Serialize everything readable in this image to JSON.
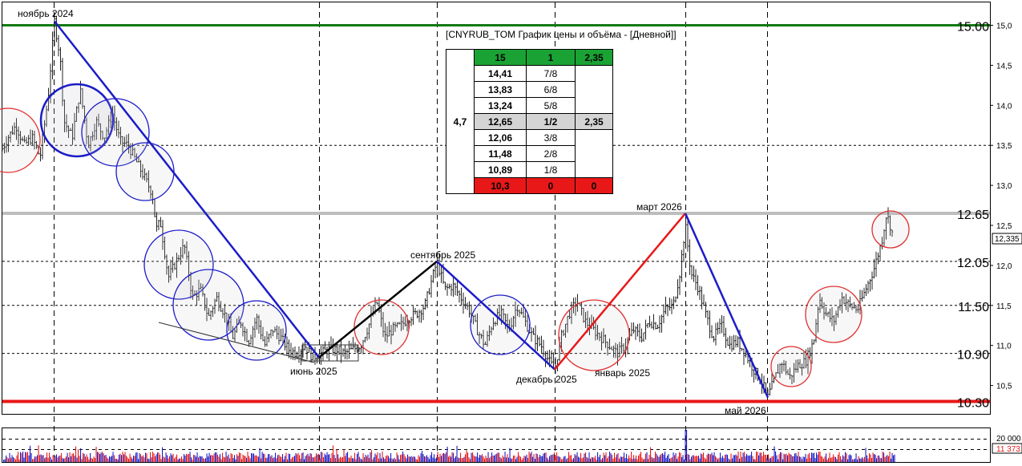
{
  "chart_data": {
    "type": "candlestick",
    "instrument_title": "[CNYRUB_TOM График цены и объёма - [Дневной]]",
    "ylim": [
      10.27,
      15.12
    ],
    "y_ticks": [
      "15,0",
      "14,5",
      "14,0",
      "13,5",
      "13,0",
      "12,5",
      "12,0",
      "11,5",
      "11,0",
      "10,5"
    ],
    "y_tick_values": [
      15.0,
      14.5,
      14.0,
      13.5,
      13.0,
      12.5,
      12.0,
      11.5,
      11.0,
      10.5
    ],
    "levels": [
      {
        "value": 15.0,
        "label": "15.00",
        "color": "#117a11"
      },
      {
        "value": 12.65,
        "label": "12.65",
        "color": "#bdbdbd"
      },
      {
        "value": 12.05,
        "label": "12.05",
        "color": "#000000"
      },
      {
        "value": 11.5,
        "label": "11.50",
        "color": "#000000"
      },
      {
        "value": 10.9,
        "label": "10.90",
        "color": "#000000"
      },
      {
        "value": 10.3,
        "label": "10.30",
        "color": "#e81818"
      }
    ],
    "last_price": "12,335",
    "volume_ticks": [
      "20 000",
      "11 373"
    ],
    "swing_labels": [
      {
        "label": "ноябрь 2024",
        "value": 15.05
      },
      {
        "label": "июнь 2025",
        "value": 10.85
      },
      {
        "label": "сентябрь 2025",
        "value": 12.05
      },
      {
        "label": "декабрь 2025",
        "value": 10.7
      },
      {
        "label": "январь 2025",
        "value": 10.85
      },
      {
        "label": "март 2026",
        "value": 12.65
      },
      {
        "label": "май 2026",
        "value": 10.35
      }
    ],
    "trend_lines": [
      {
        "from": 15.05,
        "to": 10.85,
        "color": "#1c1cc8"
      },
      {
        "from": 10.85,
        "to": 12.05,
        "color": "#000000"
      },
      {
        "from": 12.05,
        "to": 10.7,
        "color": "#1c1cc8"
      },
      {
        "from": 10.7,
        "to": 12.65,
        "color": "#e81818"
      },
      {
        "from": 12.65,
        "to": 10.35,
        "color": "#1c1cc8"
      }
    ],
    "price_path": [
      [
        0,
        13.4
      ],
      [
        10,
        13.6
      ],
      [
        20,
        13.75
      ],
      [
        30,
        13.5
      ],
      [
        40,
        13.6
      ],
      [
        50,
        13.35
      ],
      [
        60,
        14.1
      ],
      [
        68,
        15.05
      ],
      [
        75,
        14.6
      ],
      [
        80,
        13.8
      ],
      [
        90,
        13.6
      ],
      [
        100,
        14.2
      ],
      [
        110,
        13.5
      ],
      [
        120,
        13.8
      ],
      [
        130,
        13.6
      ],
      [
        140,
        13.9
      ],
      [
        150,
        13.55
      ],
      [
        160,
        13.5
      ],
      [
        170,
        13.3
      ],
      [
        180,
        13.1
      ],
      [
        190,
        12.9
      ],
      [
        195,
        12.45
      ],
      [
        200,
        12.55
      ],
      [
        210,
        11.85
      ],
      [
        220,
        12.05
      ],
      [
        230,
        12.25
      ],
      [
        240,
        11.6
      ],
      [
        250,
        11.7
      ],
      [
        260,
        11.35
      ],
      [
        270,
        11.6
      ],
      [
        280,
        11.4
      ],
      [
        290,
        11.1
      ],
      [
        300,
        11.3
      ],
      [
        310,
        11.05
      ],
      [
        320,
        11.35
      ],
      [
        330,
        11.0
      ],
      [
        340,
        11.2
      ],
      [
        350,
        11.1
      ],
      [
        360,
        10.95
      ],
      [
        370,
        10.9
      ],
      [
        380,
        11.0
      ],
      [
        390,
        10.85
      ],
      [
        400,
        10.9
      ],
      [
        410,
        10.95
      ],
      [
        420,
        10.95
      ],
      [
        430,
        10.9
      ],
      [
        440,
        10.95
      ],
      [
        450,
        11.0
      ],
      [
        460,
        11.25
      ],
      [
        470,
        11.55
      ],
      [
        480,
        11.1
      ],
      [
        490,
        11.2
      ],
      [
        500,
        11.25
      ],
      [
        510,
        11.35
      ],
      [
        520,
        11.4
      ],
      [
        530,
        11.5
      ],
      [
        545,
        12.05
      ],
      [
        555,
        11.7
      ],
      [
        565,
        11.75
      ],
      [
        575,
        11.6
      ],
      [
        585,
        11.45
      ],
      [
        595,
        11.2
      ],
      [
        605,
        11.0
      ],
      [
        615,
        11.3
      ],
      [
        625,
        11.4
      ],
      [
        635,
        11.2
      ],
      [
        645,
        11.5
      ],
      [
        655,
        11.3
      ],
      [
        665,
        11.1
      ],
      [
        675,
        11.0
      ],
      [
        685,
        10.8
      ],
      [
        692,
        10.7
      ],
      [
        700,
        11.1
      ],
      [
        710,
        11.4
      ],
      [
        720,
        11.55
      ],
      [
        730,
        11.3
      ],
      [
        740,
        11.2
      ],
      [
        750,
        11.1
      ],
      [
        760,
        11.0
      ],
      [
        770,
        10.9
      ],
      [
        780,
        11.0
      ],
      [
        790,
        11.2
      ],
      [
        800,
        11.1
      ],
      [
        810,
        11.3
      ],
      [
        820,
        11.25
      ],
      [
        830,
        11.45
      ],
      [
        840,
        11.5
      ],
      [
        848,
        11.9
      ],
      [
        855,
        12.5
      ],
      [
        862,
        11.9
      ],
      [
        870,
        11.75
      ],
      [
        880,
        11.4
      ],
      [
        890,
        11.1
      ],
      [
        900,
        11.25
      ],
      [
        910,
        11.0
      ],
      [
        920,
        11.05
      ],
      [
        930,
        10.9
      ],
      [
        940,
        10.7
      ],
      [
        950,
        10.55
      ],
      [
        958,
        10.35
      ],
      [
        965,
        10.55
      ],
      [
        975,
        10.8
      ],
      [
        985,
        10.6
      ],
      [
        995,
        10.75
      ],
      [
        1005,
        10.8
      ],
      [
        1015,
        11.05
      ],
      [
        1022,
        11.6
      ],
      [
        1030,
        11.4
      ],
      [
        1040,
        11.3
      ],
      [
        1050,
        11.6
      ],
      [
        1060,
        11.5
      ],
      [
        1070,
        11.45
      ],
      [
        1080,
        11.7
      ],
      [
        1090,
        11.95
      ],
      [
        1100,
        12.3
      ],
      [
        1106,
        12.65
      ],
      [
        1112,
        12.45
      ],
      [
        1115,
        12.33
      ]
    ]
  },
  "gann_table": {
    "side_label": "4,7",
    "rows": [
      {
        "price": "15",
        "fraction": "1",
        "range": "2,35",
        "style": "green"
      },
      {
        "price": "14,41",
        "fraction": "7/8",
        "range": "",
        "style": "normal"
      },
      {
        "price": "13,83",
        "fraction": "6/8",
        "range": "",
        "style": "normal"
      },
      {
        "price": "13,24",
        "fraction": "5/8",
        "range": "",
        "style": "normal"
      },
      {
        "price": "12,65",
        "fraction": "1/2",
        "range": "2,35",
        "style": "mid"
      },
      {
        "price": "12,06",
        "fraction": "3/8",
        "range": "",
        "style": "normal"
      },
      {
        "price": "11,48",
        "fraction": "2/8",
        "range": "",
        "style": "normal"
      },
      {
        "price": "10,89",
        "fraction": "1/8",
        "range": "",
        "style": "normal"
      },
      {
        "price": "10,3",
        "fraction": "0",
        "range": "0",
        "style": "red"
      }
    ]
  }
}
